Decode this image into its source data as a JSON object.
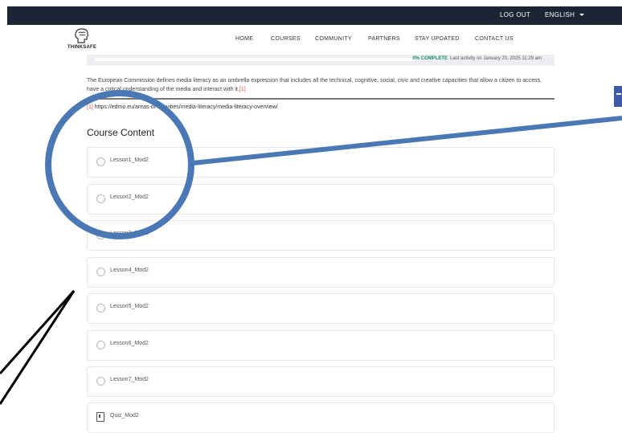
{
  "topbar": {
    "logout_label": "LOG OUT",
    "language_label": "ENGLISH"
  },
  "logo": {
    "text": "THINKSAFE"
  },
  "nav": {
    "items": [
      {
        "label": "HOME"
      },
      {
        "label": "COURSES"
      },
      {
        "label": "COMMUNITY"
      },
      {
        "label": "PARTNERS"
      },
      {
        "label": "STAY UPDATED"
      },
      {
        "label": "CONTACT US"
      }
    ]
  },
  "progress": {
    "percent": 0,
    "percent_label": "0% COMPLETE",
    "last_activity": "Last activity on January 20, 2025 11:29 am"
  },
  "content": {
    "paragraph": "The European Commission defines media literacy as an umbrella expression that includes all the technical, cognitive, social, civic and creative capacities that allow a citizen to access, have a critical understanding of the media and interact with it.",
    "citation_marker": "[1]",
    "footnote_marker": "[1]",
    "footnote_url": "https://edmo.eu/areas-of-activities/media-literacy/media-literacy-overview/"
  },
  "course_content": {
    "title": "Course Content",
    "lessons": [
      {
        "label": "Lesson1_Mod2",
        "type": "lesson"
      },
      {
        "label": "Lesson2_Mod2",
        "type": "lesson"
      },
      {
        "label": "Lesson3_Mod2",
        "type": "lesson"
      },
      {
        "label": "Lesson4_Mod2",
        "type": "lesson"
      },
      {
        "label": "Lesson5_Mod2",
        "type": "lesson"
      },
      {
        "label": "Lesson6_Mod2",
        "type": "lesson"
      },
      {
        "label": "Lesson7_Mod2",
        "type": "lesson"
      },
      {
        "label": "Quiz_Mod2",
        "type": "quiz"
      }
    ]
  },
  "colors": {
    "topbar_bg": "#1d2534",
    "progress_accent": "#1a8f6d",
    "citation": "#d9534f",
    "annotation_stroke": "#4a78b5",
    "side_tab": "#3f5aa8"
  }
}
